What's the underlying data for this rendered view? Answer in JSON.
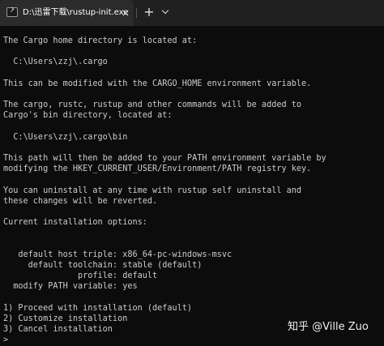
{
  "tab": {
    "title": "D:\\迅雷下载\\rustup-init.exe",
    "close": "×",
    "new": "+"
  },
  "console": {
    "lines": [
      "The Cargo home directory is located at:",
      "",
      "  C:\\Users\\zzj\\.cargo",
      "",
      "This can be modified with the CARGO_HOME environment variable.",
      "",
      "The cargo, rustc, rustup and other commands will be added to",
      "Cargo's bin directory, located at:",
      "",
      "  C:\\Users\\zzj\\.cargo\\bin",
      "",
      "This path will then be added to your PATH environment variable by",
      "modifying the HKEY_CURRENT_USER/Environment/PATH registry key.",
      "",
      "You can uninstall at any time with rustup self uninstall and",
      "these changes will be reverted.",
      "",
      "Current installation options:",
      "",
      "",
      "   default host triple: x86_64-pc-windows-msvc",
      "     default toolchain: stable (default)",
      "               profile: default",
      "  modify PATH variable: yes",
      "",
      "1) Proceed with installation (default)",
      "2) Customize installation",
      "3) Cancel installation"
    ],
    "prompt": ">"
  },
  "watermark": "知乎 @Ville Zuo"
}
